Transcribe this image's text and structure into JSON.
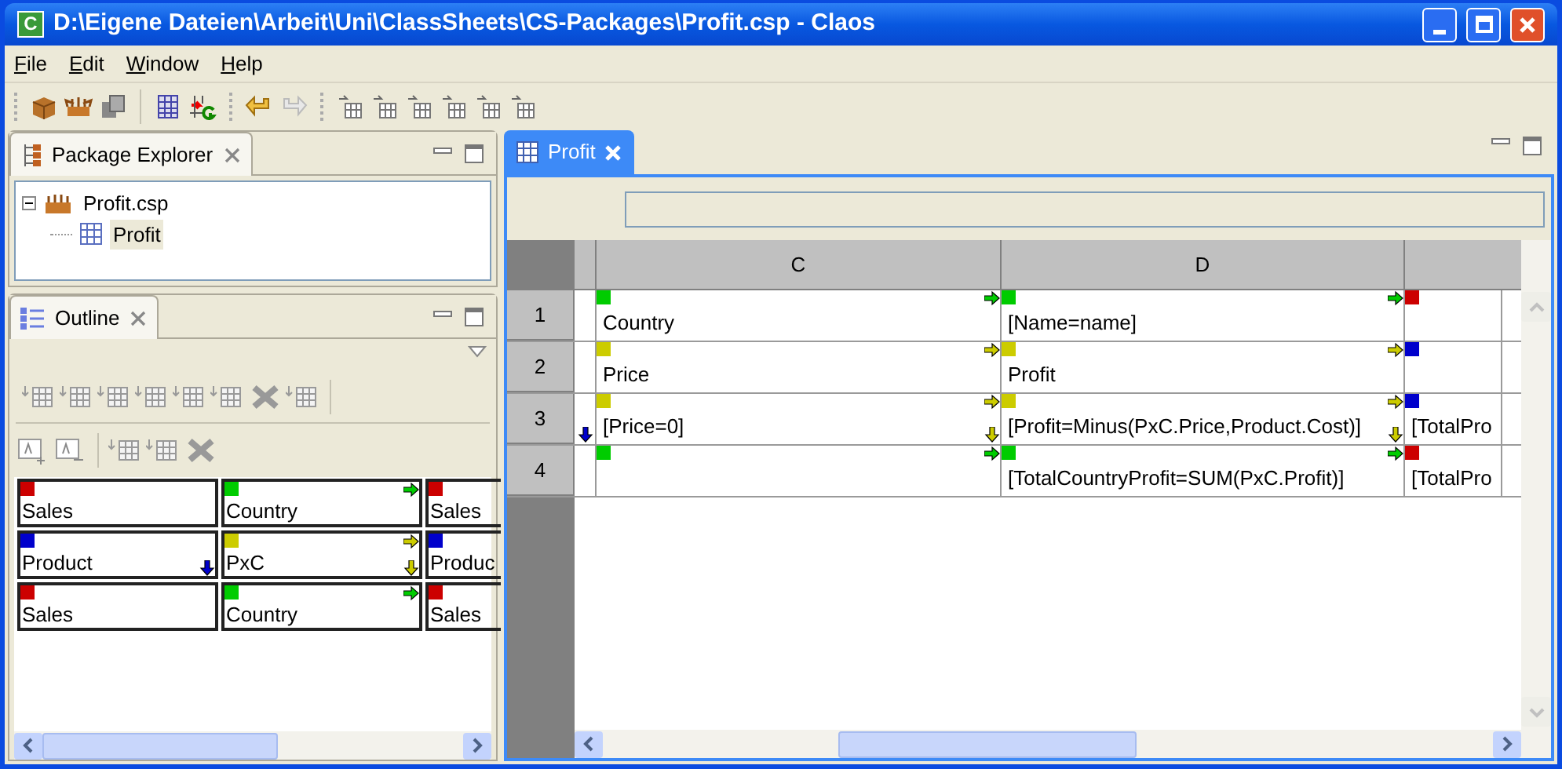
{
  "window": {
    "icon_letter": "C",
    "title": "D:\\Eigene Dateien\\Arbeit\\Uni\\ClassSheets\\CS-Packages\\Profit.csp - Claos"
  },
  "menu": [
    {
      "label": "File"
    },
    {
      "label": "Edit"
    },
    {
      "label": "Window"
    },
    {
      "label": "Help"
    }
  ],
  "package_explorer": {
    "title": "Package Explorer",
    "tree": [
      {
        "label": "Profit.csp",
        "expanded": true,
        "selected": false,
        "children": [
          {
            "label": "Profit",
            "selected": true
          }
        ]
      }
    ]
  },
  "outline": {
    "title": "Outline",
    "rows": [
      {
        "cells": [
          {
            "text": "Sales",
            "color": "#cc0000",
            "right_arrow": false,
            "down_arrow": false
          },
          {
            "text": "Country",
            "color": "#00cc00",
            "right_arrow": true,
            "down_arrow": false
          },
          {
            "text": "Sales",
            "color": "#cc0000",
            "right_arrow": false,
            "down_arrow": false
          }
        ]
      },
      {
        "cells": [
          {
            "text": "Product",
            "color": "#0000cc",
            "right_arrow": false,
            "down_arrow": true
          },
          {
            "text": "PxC",
            "color": "#cccc00",
            "right_arrow": true,
            "down_arrow": true
          },
          {
            "text": "Produc",
            "color": "#0000cc",
            "right_arrow": false,
            "down_arrow": false
          }
        ]
      },
      {
        "cells": [
          {
            "text": "Sales",
            "color": "#cc0000",
            "right_arrow": false,
            "down_arrow": false
          },
          {
            "text": "Country",
            "color": "#00cc00",
            "right_arrow": true,
            "down_arrow": false
          },
          {
            "text": "Sales",
            "color": "#cc0000",
            "right_arrow": false,
            "down_arrow": false
          }
        ]
      }
    ]
  },
  "editor": {
    "tab": {
      "label": "Profit",
      "selected": true
    },
    "column_headers": [
      "C",
      "D"
    ],
    "rows": [
      {
        "number": "1",
        "cells": [
          {
            "text": "Country",
            "color": "#00cc00",
            "right_arrow": true,
            "down_arrow": false
          },
          {
            "text": "[Name=name]",
            "color": "#00cc00",
            "right_arrow": true,
            "down_arrow": false
          },
          {
            "color": "#cc0000",
            "right_arrow": false,
            "down_arrow": false
          }
        ]
      },
      {
        "number": "2",
        "cells": [
          {
            "text": "Price",
            "color": "#cccc00",
            "right_arrow": true,
            "down_arrow": false
          },
          {
            "text": "Profit",
            "color": "#cccc00",
            "right_arrow": true,
            "down_arrow": false
          },
          {
            "color": "#0000cc",
            "right_arrow": false,
            "down_arrow": false
          }
        ]
      },
      {
        "number": "3",
        "side": {
          "color": "#0000cc",
          "down_arrow": true
        },
        "cells": [
          {
            "text": "[Price=0]",
            "color": "#cccc00",
            "right_arrow": true,
            "down_arrow": true
          },
          {
            "text": "[Profit=Minus(PxC.Price,Product.Cost)]",
            "color": "#cccc00",
            "right_arrow": true,
            "down_arrow": true
          },
          {
            "text": "[TotalPro",
            "color": "#0000cc",
            "right_arrow": false,
            "down_arrow": false
          }
        ]
      },
      {
        "number": "4",
        "cells": [
          {
            "color": "#00cc00",
            "right_arrow": true,
            "down_arrow": false
          },
          {
            "text": "[TotalCountryProfit=SUM(PxC.Profit)]",
            "color": "#00cc00",
            "right_arrow": true,
            "down_arrow": false
          },
          {
            "text": "[TotalPro",
            "color": "#cc0000",
            "right_arrow": false,
            "down_arrow": false
          }
        ]
      }
    ]
  }
}
